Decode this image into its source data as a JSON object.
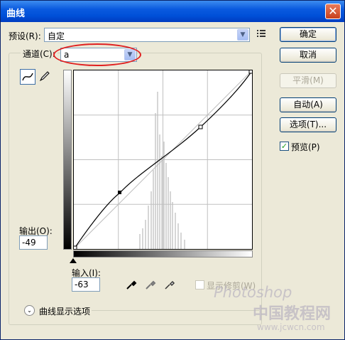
{
  "window": {
    "title": "曲线",
    "close_glyph": "✕"
  },
  "preset": {
    "label": "预设(R):",
    "value": "自定"
  },
  "channel": {
    "label": "通道(C):",
    "value": "a"
  },
  "buttons": {
    "ok": "确定",
    "cancel": "取消",
    "smooth": "平滑(M)",
    "auto": "自动(A)",
    "options": "选项(T)..."
  },
  "preview": {
    "label": "预览(P)",
    "checked": true
  },
  "output": {
    "label": "输出(O):",
    "value": "-49"
  },
  "input": {
    "label": "输入(I):",
    "value": "-63"
  },
  "show_clipping": {
    "label": "显示修剪(W)",
    "checked": false
  },
  "curve_options": {
    "label": "曲线显示选项"
  },
  "watermark": {
    "text1": "Photoshop",
    "text2": "中国教程网",
    "url": "www.jcwcn.com"
  }
}
